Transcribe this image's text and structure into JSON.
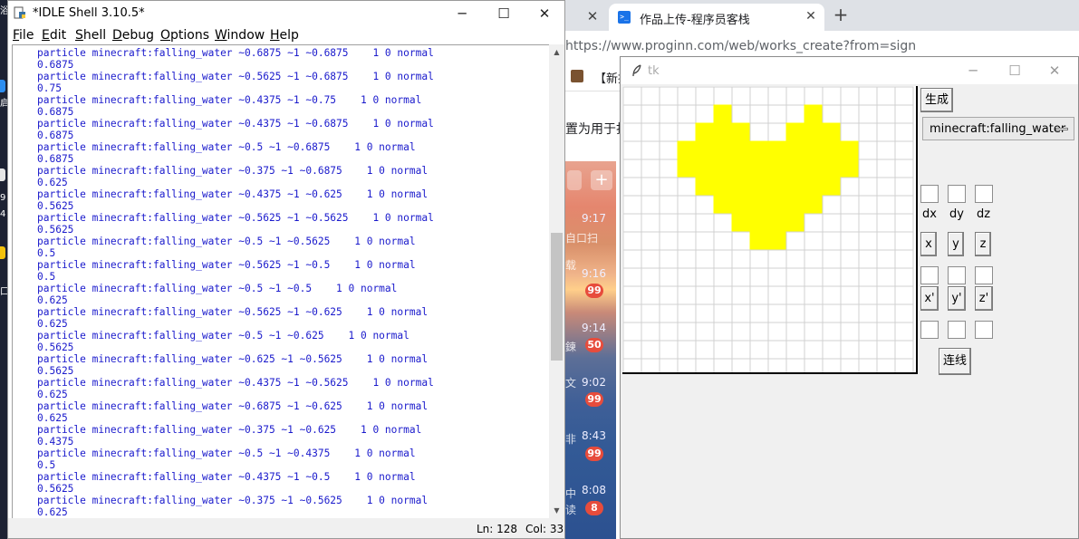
{
  "desktop": {
    "strip_fragments": [
      "浴",
      "启",
      "9",
      "4",
      "口"
    ]
  },
  "browser": {
    "prev_tab_close": "✕",
    "active_tab": {
      "title": "作品上传-程序员客栈",
      "favicon": ">_",
      "close": "✕"
    },
    "new_tab": "+",
    "url": "https://www.proginn.com/web/works_create?from=sign",
    "bookmark": "【新提",
    "page_text": "置为用于打",
    "chat": {
      "plus": "+",
      "items": [
        {
          "time": "9:17",
          "frag": "自口扫"
        },
        {
          "time": "9:16",
          "badge": "99"
        },
        {
          "time": "9:14",
          "badge": "50"
        },
        {
          "time": "9:02",
          "badge": "99",
          "frag": "文"
        },
        {
          "time": "8:43",
          "badge": "99",
          "frag": "非"
        },
        {
          "time": "8:08",
          "badge": "8",
          "frag": "中"
        }
      ],
      "extra_frags": [
        "载",
        "鍊",
        "读"
      ]
    }
  },
  "idle": {
    "title": "*IDLE Shell 3.10.5*",
    "window_buttons": {
      "minimize": "─",
      "maximize": "☐",
      "close": "✕"
    },
    "menu": [
      {
        "label": "File",
        "u": "F",
        "rest": "ile"
      },
      {
        "label": "Edit",
        "u": "E",
        "rest": "dit"
      },
      {
        "label": "Shell",
        "u": "S",
        "rest": "hell"
      },
      {
        "label": "Debug",
        "u": "D",
        "rest": "ebug"
      },
      {
        "label": "Options",
        "u": "O",
        "rest": "ptions"
      },
      {
        "label": "Window",
        "u": "W",
        "rest": "indow"
      },
      {
        "label": "Help",
        "u": "H",
        "rest": "elp"
      }
    ],
    "lines": [
      "particle minecraft:falling_water ~0.6875 ~1 ~0.6875    1 0 normal",
      "0.6875",
      "particle minecraft:falling_water ~0.5625 ~1 ~0.6875    1 0 normal",
      "0.75",
      "particle minecraft:falling_water ~0.4375 ~1 ~0.75    1 0 normal",
      "0.6875",
      "particle minecraft:falling_water ~0.4375 ~1 ~0.6875    1 0 normal",
      "0.6875",
      "particle minecraft:falling_water ~0.5 ~1 ~0.6875    1 0 normal",
      "0.6875",
      "particle minecraft:falling_water ~0.375 ~1 ~0.6875    1 0 normal",
      "0.625",
      "particle minecraft:falling_water ~0.4375 ~1 ~0.625    1 0 normal",
      "0.5625",
      "particle minecraft:falling_water ~0.5625 ~1 ~0.5625    1 0 normal",
      "0.5625",
      "particle minecraft:falling_water ~0.5 ~1 ~0.5625    1 0 normal",
      "0.5",
      "particle minecraft:falling_water ~0.5625 ~1 ~0.5    1 0 normal",
      "0.5",
      "particle minecraft:falling_water ~0.5 ~1 ~0.5    1 0 normal",
      "0.625",
      "particle minecraft:falling_water ~0.5625 ~1 ~0.625    1 0 normal",
      "0.625",
      "particle minecraft:falling_water ~0.5 ~1 ~0.625    1 0 normal",
      "0.5625",
      "particle minecraft:falling_water ~0.625 ~1 ~0.5625    1 0 normal",
      "0.5625",
      "particle minecraft:falling_water ~0.4375 ~1 ~0.5625    1 0 normal",
      "0.625",
      "particle minecraft:falling_water ~0.6875 ~1 ~0.625    1 0 normal",
      "0.625",
      "particle minecraft:falling_water ~0.375 ~1 ~0.625    1 0 normal",
      "0.4375",
      "particle minecraft:falling_water ~0.5 ~1 ~0.4375    1 0 normal",
      "0.5",
      "particle minecraft:falling_water ~0.4375 ~1 ~0.5    1 0 normal",
      "0.5625",
      "particle minecraft:falling_water ~0.375 ~1 ~0.5625    1 0 normal",
      "0.625"
    ],
    "status": {
      "ln": "Ln: 128",
      "col": "Col: 33"
    }
  },
  "tk": {
    "title": "tk",
    "window_buttons": {
      "minimize": "─",
      "maximize": "☐",
      "close": "✕"
    },
    "generate_button": "生成",
    "particle_select": "minecraft:falling_water",
    "labels": {
      "dx": "dx",
      "dy": "dy",
      "dz": "dz"
    },
    "buttons": {
      "x": "x",
      "y": "y",
      "z": "z",
      "xp": "x'",
      "yp": "y'",
      "zp": "z'",
      "connect": "连线"
    },
    "grid": {
      "cols": 16,
      "rows": 16,
      "fill_color": "#ffff00",
      "line_color": "#d0d0d0",
      "filled": [
        [
          5,
          1
        ],
        [
          10,
          1
        ],
        [
          4,
          2
        ],
        [
          5,
          2
        ],
        [
          6,
          2
        ],
        [
          9,
          2
        ],
        [
          10,
          2
        ],
        [
          11,
          2
        ],
        [
          3,
          3
        ],
        [
          4,
          3
        ],
        [
          5,
          3
        ],
        [
          6,
          3
        ],
        [
          7,
          3
        ],
        [
          8,
          3
        ],
        [
          9,
          3
        ],
        [
          10,
          3
        ],
        [
          11,
          3
        ],
        [
          12,
          3
        ],
        [
          3,
          4
        ],
        [
          4,
          4
        ],
        [
          5,
          4
        ],
        [
          6,
          4
        ],
        [
          7,
          4
        ],
        [
          8,
          4
        ],
        [
          9,
          4
        ],
        [
          10,
          4
        ],
        [
          11,
          4
        ],
        [
          12,
          4
        ],
        [
          4,
          5
        ],
        [
          5,
          5
        ],
        [
          6,
          5
        ],
        [
          7,
          5
        ],
        [
          8,
          5
        ],
        [
          9,
          5
        ],
        [
          10,
          5
        ],
        [
          11,
          5
        ],
        [
          5,
          6
        ],
        [
          6,
          6
        ],
        [
          7,
          6
        ],
        [
          8,
          6
        ],
        [
          9,
          6
        ],
        [
          10,
          6
        ],
        [
          6,
          7
        ],
        [
          7,
          7
        ],
        [
          8,
          7
        ],
        [
          9,
          7
        ],
        [
          7,
          8
        ],
        [
          8,
          8
        ]
      ]
    }
  }
}
